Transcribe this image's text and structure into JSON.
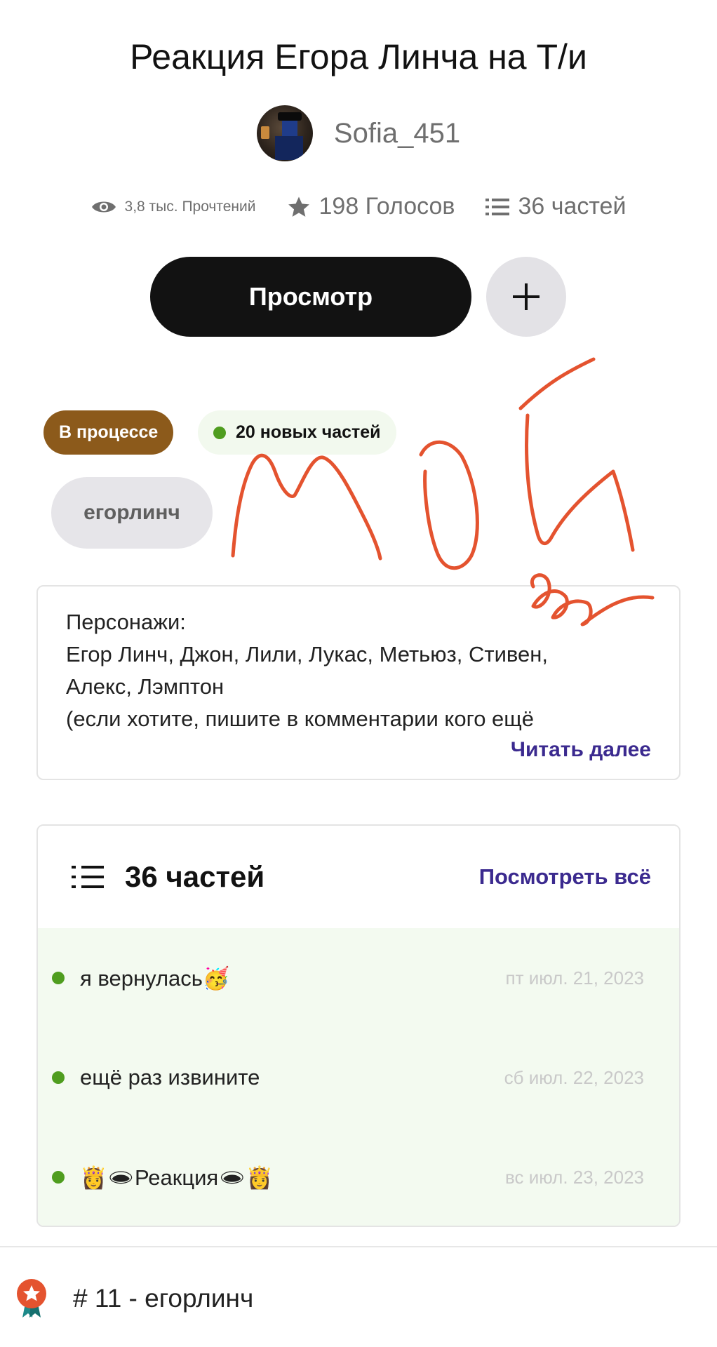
{
  "story": {
    "title": "Реакция Егора Линча на Т/и",
    "author": "Sofia_451"
  },
  "stats": {
    "reads": "3,8 тыс. Прочтений",
    "votes": "198 Голосов",
    "parts": "36 частей"
  },
  "actions": {
    "view_label": "Просмотр",
    "add_icon": "plus-icon"
  },
  "badges": {
    "status": "В процессе",
    "new_parts": "20 новых частей"
  },
  "tags": [
    "егорлинч"
  ],
  "annotation": {
    "handwriting": "мой"
  },
  "description": {
    "lines": [
      "Персонажи:",
      "Егор Линч, Джон, Лили, Лукас, Метьюз, Стивен,",
      "Алекс, Лэмптон",
      "(если хотите, пишите в комментарии кого ещё"
    ],
    "read_more": "Читать далее"
  },
  "parts_section": {
    "count_label": "36 частей",
    "see_all": "Посмотреть всё",
    "items": [
      {
        "title": "я вернулась🥳",
        "date": "пт июл. 21, 2023"
      },
      {
        "title": "ещё раз извините",
        "date": "сб июл. 22, 2023"
      },
      {
        "title": "👸🕳Реакция🕳👸",
        "date": "вс июл. 23, 2023"
      }
    ]
  },
  "ranking": {
    "text": "# 11 - егорлинч"
  },
  "colors": {
    "status_badge": "#8c5a1b",
    "new_dot": "#4f9d1f",
    "link": "#3b2a8f",
    "scribble": "#e4532f"
  }
}
